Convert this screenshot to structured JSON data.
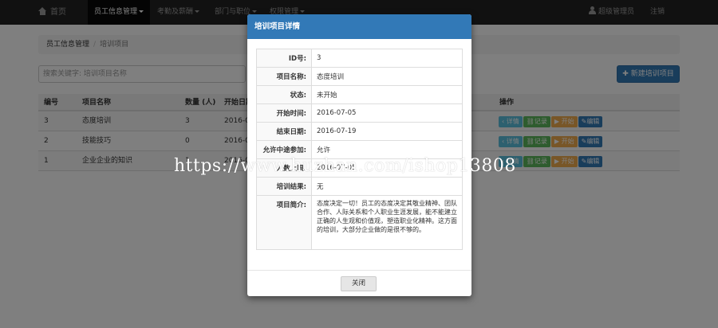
{
  "navbar": {
    "home": "首页",
    "menus": [
      "员工信息管理",
      "考勤及薪酬",
      "部门与职位",
      "权限管理"
    ],
    "user": "超级管理员",
    "logout": "注销"
  },
  "breadcrumb": {
    "parent": "员工信息管理",
    "current": "培训项目"
  },
  "search": {
    "placeholder": "搜索关键字: 培训项目名称",
    "value": ""
  },
  "new_button": "新建培训项目",
  "table": {
    "headers": [
      "编号",
      "项目名称",
      "数量 (人)",
      "开始日期",
      "操作"
    ],
    "rows": [
      {
        "id": "3",
        "name": "态度培训",
        "count": "3",
        "start": "2016-07"
      },
      {
        "id": "2",
        "name": "技能技巧",
        "count": "0",
        "start": "2016-07"
      },
      {
        "id": "1",
        "name": "企业企业的知识",
        "count": "1",
        "start": "2016-0"
      }
    ],
    "actions": {
      "detail": "详情",
      "record": "记录",
      "start": "开始",
      "edit": "编辑"
    }
  },
  "modal": {
    "title": "培训项目详情",
    "fields": [
      {
        "label": "ID号:",
        "value": "3"
      },
      {
        "label": "项目名称:",
        "value": "态度培训"
      },
      {
        "label": "状态:",
        "value": "未开始"
      },
      {
        "label": "开始时间:",
        "value": "2016-07-05"
      },
      {
        "label": "结束日期:",
        "value": "2016-07-19"
      },
      {
        "label": "允许中途参加:",
        "value": "允许"
      },
      {
        "label": "人数上限:",
        "value": "2016-07-05"
      },
      {
        "label": "培训结果:",
        "value": "无"
      },
      {
        "label": "项目简介:",
        "value": "态度决定一切！员工的态度决定其敬业精神、团队合作、人际关系和个人职业生涯发展，能不能建立正确的人生观和价值观，塑造职业化精神。这方面的培训，大部分企业做的是很不够的。"
      }
    ],
    "close": "关闭"
  },
  "watermark": "https://www.huzhan.com/ishop13808",
  "colors": {
    "navbar": "#222222",
    "modal_header": "#3279b7",
    "primary": "#337ab7",
    "info": "#5bc0de",
    "success": "#5cb85c",
    "warning": "#f0ad4e"
  }
}
